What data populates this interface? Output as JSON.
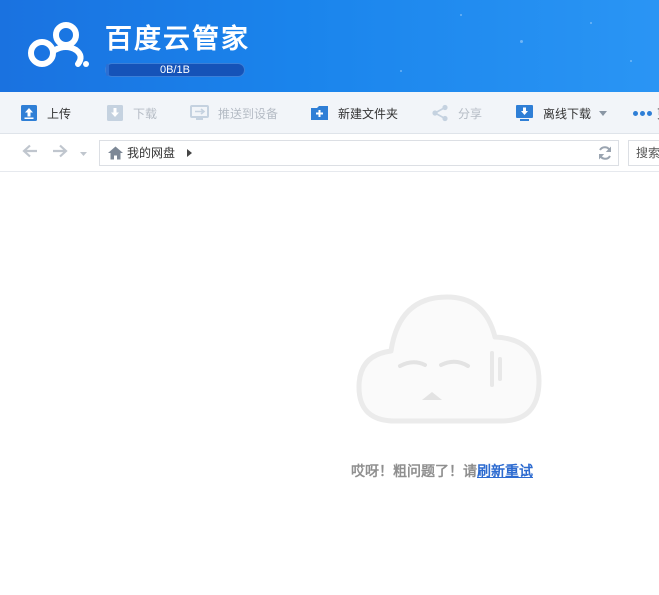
{
  "app": {
    "title": "百度云管家",
    "quota_text": "0B/1B",
    "quota_fraction": 0.02
  },
  "toolbar": {
    "upload": "上传",
    "download": "下载",
    "push_to_device": "推送到设备",
    "new_folder": "新建文件夹",
    "share": "分享",
    "offline_download": "离线下载",
    "more": "更"
  },
  "nav": {
    "breadcrumb_root": "我的网盘",
    "search_placeholder": "搜索"
  },
  "main": {
    "error_message": "哎呀！粗问题了！请",
    "retry_link": "刷新重试"
  },
  "colors": {
    "header_blue": "#1a7ae6",
    "link_blue": "#2d6bd0",
    "icon_blue": "#2f7fd6",
    "disabled_gray": "#b5bcc5"
  },
  "icons": {
    "upload": "upload-icon",
    "download": "download-icon",
    "push": "push-to-device-icon",
    "new_folder": "new-folder-icon",
    "share": "share-icon",
    "offline": "offline-download-icon",
    "home": "home-icon",
    "refresh": "refresh-icon",
    "back": "back-arrow-icon",
    "forward": "forward-arrow-icon",
    "cloud": "sad-cloud-icon"
  }
}
